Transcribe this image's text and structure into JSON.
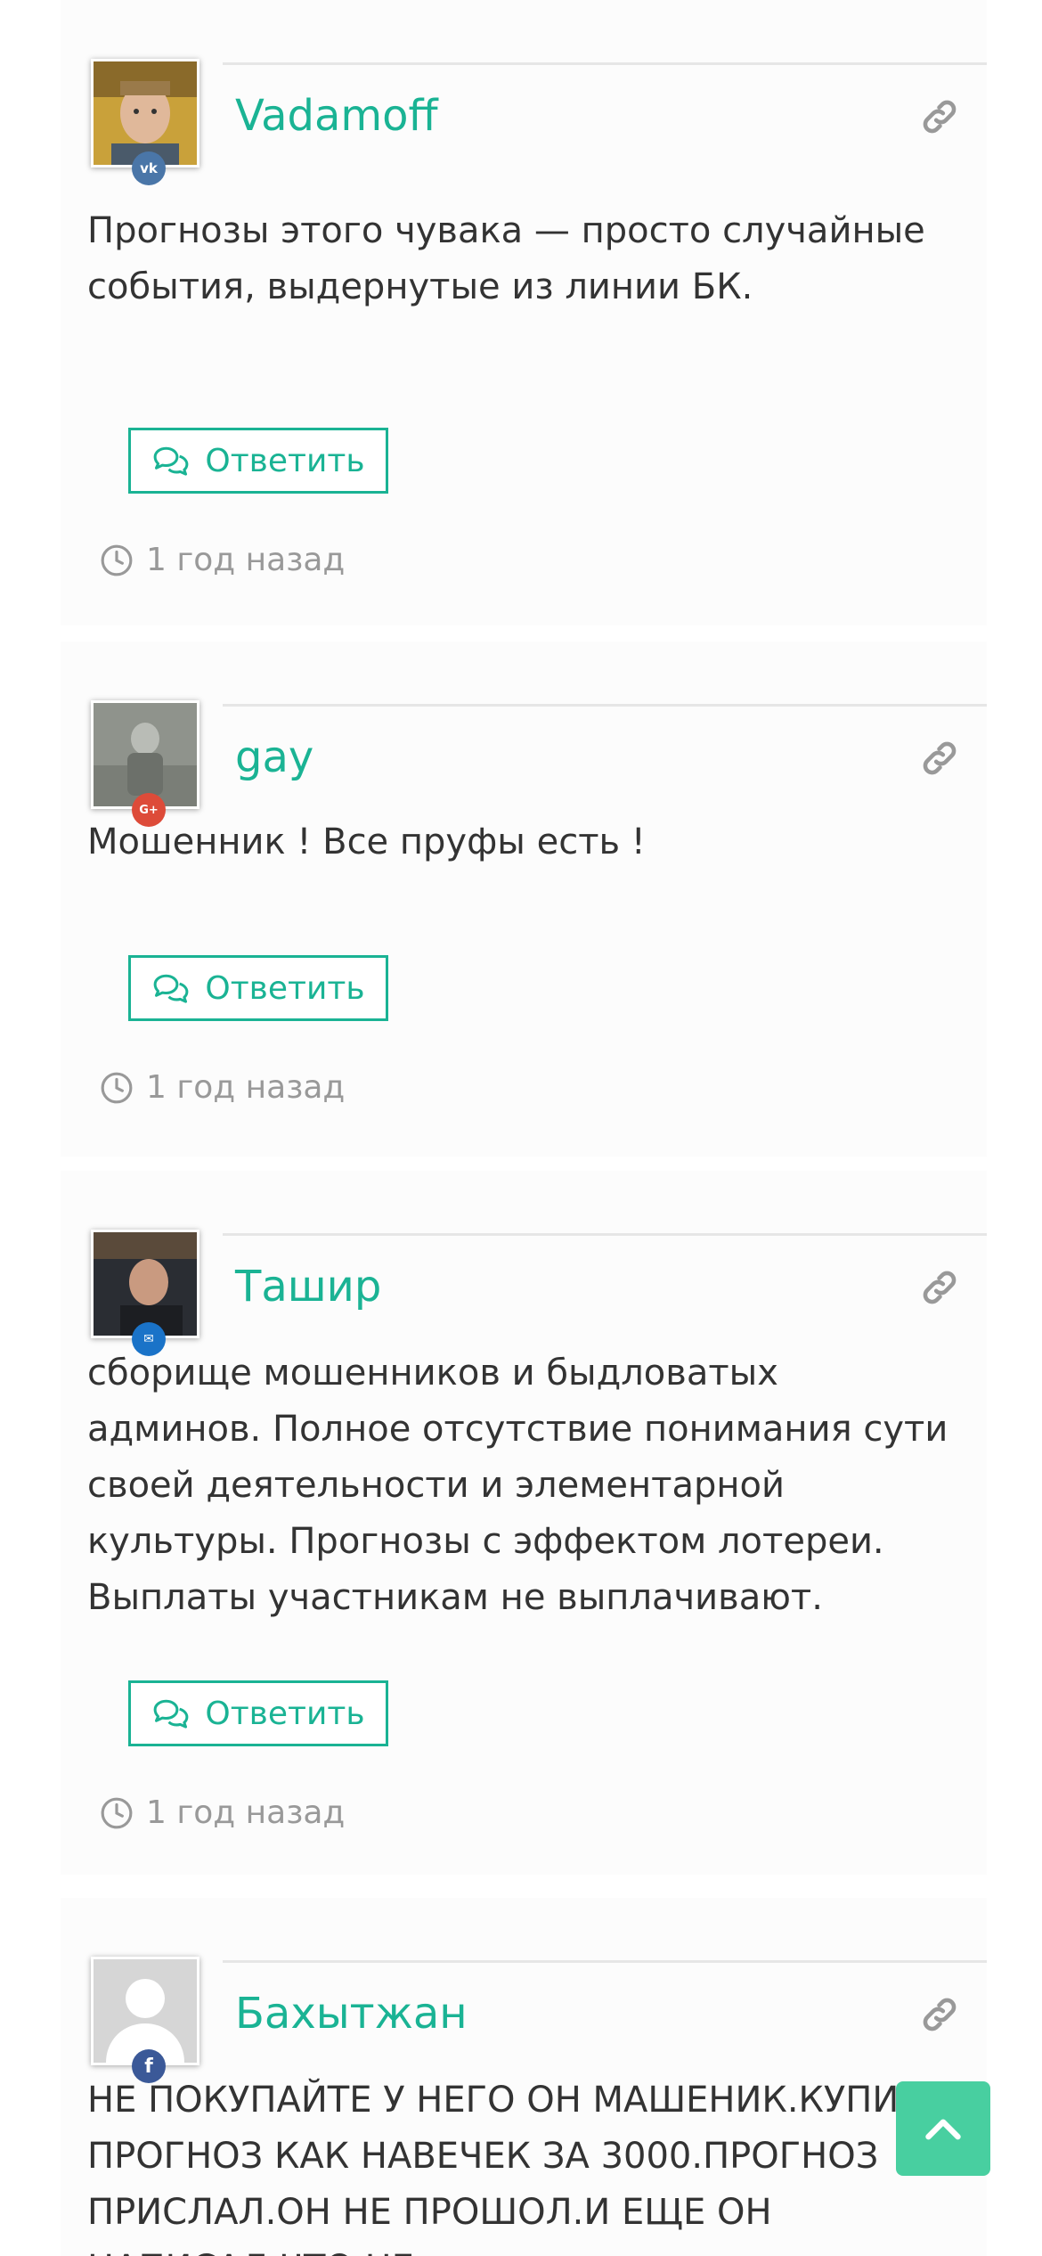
{
  "colors": {
    "accent": "#1ab394",
    "text": "#333333",
    "muted": "#999999",
    "scroll_top_bg": "#48cfa0"
  },
  "comments": [
    {
      "author": "Vadamoff",
      "social": "vk",
      "social_glyph": "vk",
      "text": "Прогнозы этого чувака — просто случайные события, выдернутые из линии БК.",
      "reply_label": "Ответить",
      "time": "1 год назад"
    },
    {
      "author": "gay",
      "social": "google-plus",
      "social_glyph": "G+",
      "text": "Мошенник ! Все пруфы есть !",
      "reply_label": "Ответить",
      "time": "1 год назад"
    },
    {
      "author": "Ташир",
      "social": "mail",
      "social_glyph": "✉",
      "text": "сборище мошенников и быдловатых админов. Полное отсутствие понимания сути своей деятельности и элементарной культуры. Прогнозы с эффектом лотереи. Выплаты участникам не выплачивают.",
      "reply_label": "Ответить",
      "time": "1 год назад"
    },
    {
      "author": "Бахытжан",
      "social": "facebook",
      "social_glyph": "f",
      "text": "НЕ ПОКУПАЙТЕ У НЕГО ОН МАШЕНИК.КУПИЛ ПРОГНОЗ КАК НАВЕЧЕК ЗА 3000.ПРОГНОЗ ПРИСЛАЛ.ОН НЕ ПРОШОЛ.И ЕЩЕ ОН НАПИСАЛ ЧТО НЕ"
    }
  ],
  "icons": {
    "link": "link-icon",
    "reply": "comments-icon",
    "time": "clock-icon",
    "scroll_top": "chevron-up-icon"
  }
}
